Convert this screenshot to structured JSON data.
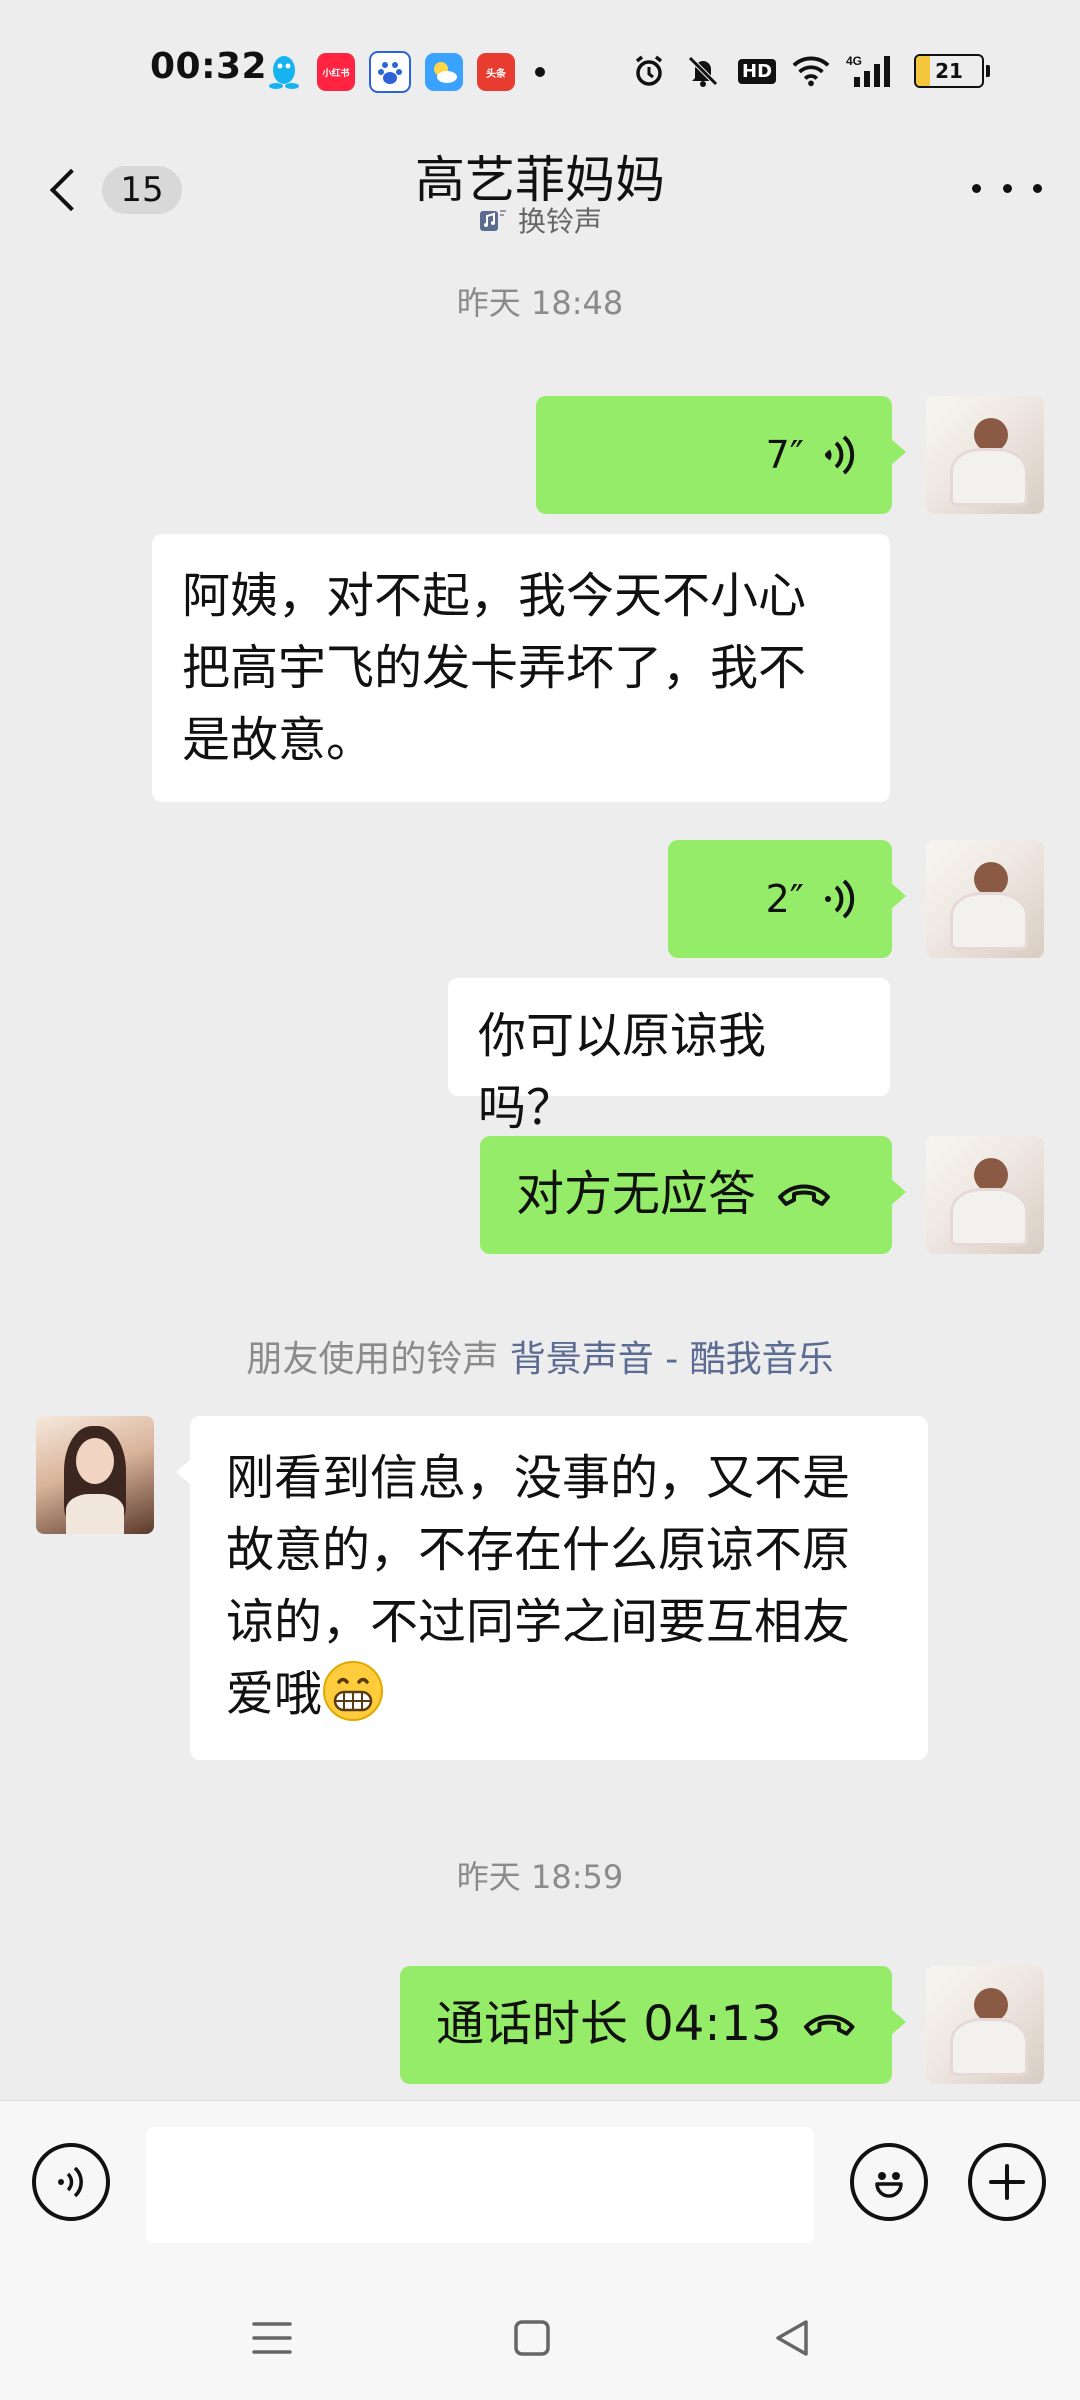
{
  "status_bar": {
    "time": "00:32",
    "app_icons": [
      "qq-icon",
      "xiaohongshu-icon",
      "baidu-icon",
      "weather-icon",
      "toutiao-icon"
    ],
    "xiaohongshu_label": "小红书",
    "toutiao_label": "头条",
    "network": "4G",
    "hd_label": "HD",
    "battery_level": "21"
  },
  "header": {
    "unread_count": "15",
    "title": "高艺菲妈妈",
    "ringtone_label": "换铃声"
  },
  "messages": [
    {
      "type": "timestamp",
      "text": "昨天 18:48"
    },
    {
      "type": "voice",
      "sender": "me",
      "duration": "7″"
    },
    {
      "type": "text",
      "sender": "me",
      "text_lines": [
        "阿姨，对不起，我今天不小心",
        "把高宇飞的发卡弄坏了，我不",
        "是故意。"
      ]
    },
    {
      "type": "voice",
      "sender": "me",
      "duration": "2″"
    },
    {
      "type": "text",
      "sender": "me",
      "text": "你可以原谅我吗？"
    },
    {
      "type": "call",
      "sender": "me",
      "text": "对方无应答"
    },
    {
      "type": "system",
      "prefix": "朋友使用的铃声 ",
      "link": "背景声音 - 酷我音乐"
    },
    {
      "type": "text",
      "sender": "other",
      "text_lines": [
        "刚看到信息，没事的，又不是",
        "故意的，不存在什么原谅不原",
        "谅的，不过同学之间要互相友",
        "爱哦"
      ],
      "emoji": "grinning-face-icon"
    },
    {
      "type": "timestamp",
      "text": "昨天 18:59"
    },
    {
      "type": "call",
      "sender": "me",
      "text": "通话时长 04:13"
    }
  ],
  "input_bar": {
    "placeholder": ""
  },
  "colors": {
    "my_bubble": "#95ec69",
    "other_bubble": "#ffffff",
    "background": "#ededed",
    "link": "#5b6b92",
    "battery": "#f3c63c"
  }
}
